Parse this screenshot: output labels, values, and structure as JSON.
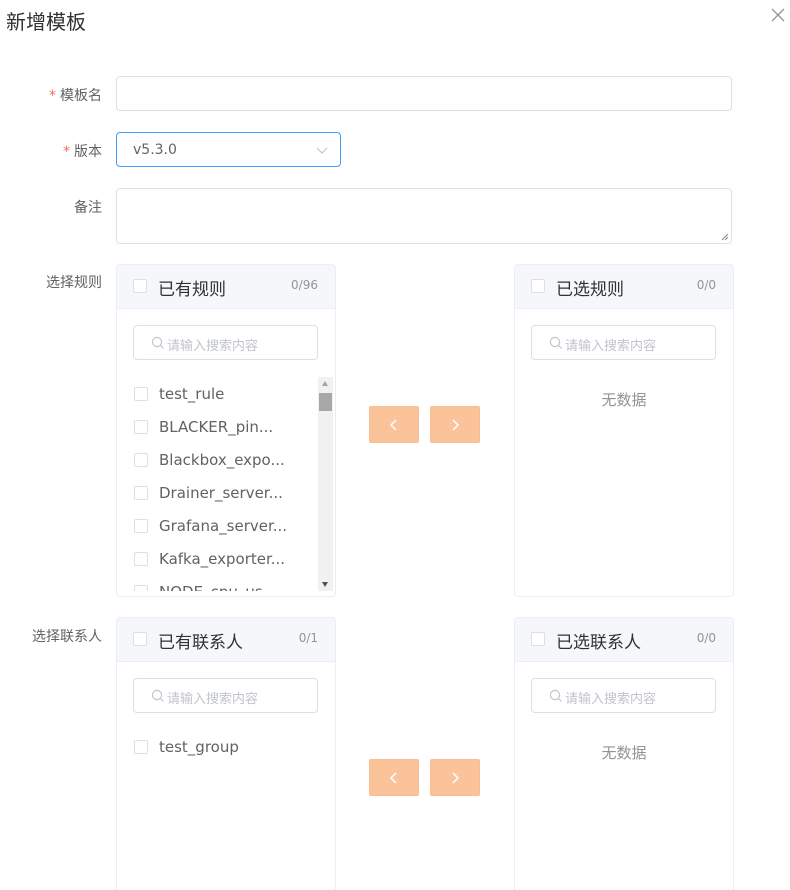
{
  "dialog": {
    "title": "新增模板"
  },
  "form": {
    "name_label": "模板名",
    "version_label": "版本",
    "version_value": "v5.3.0",
    "remark_label": "备注",
    "rules_label": "选择规则",
    "contacts_label": "选择联系人",
    "required_mark": "*"
  },
  "rules": {
    "left": {
      "title": "已有规则",
      "count": "0/96",
      "search_placeholder": "请输入搜索内容",
      "items": [
        "test_rule",
        "BLACKER_pin...",
        "Blackbox_expo...",
        "Drainer_server...",
        "Grafana_server...",
        "Kafka_exporter...",
        "NODE_cpu_us..."
      ]
    },
    "right": {
      "title": "已选规则",
      "count": "0/0",
      "search_placeholder": "请输入搜索内容",
      "empty_text": "无数据"
    }
  },
  "contacts": {
    "left": {
      "title": "已有联系人",
      "count": "0/1",
      "search_placeholder": "请输入搜索内容",
      "items": [
        "test_group"
      ]
    },
    "right": {
      "title": "已选联系人",
      "count": "0/0",
      "search_placeholder": "请输入搜索内容",
      "empty_text": "无数据"
    }
  },
  "icons": {
    "close": "close-icon",
    "chevron": "chevron-down-icon",
    "search": "search-icon",
    "move_left": "chevron-left-icon",
    "move_right": "chevron-right-icon"
  },
  "colors": {
    "accent": "#409eff",
    "required": "#f56c6c",
    "transfer_button": "#fbc39a"
  }
}
